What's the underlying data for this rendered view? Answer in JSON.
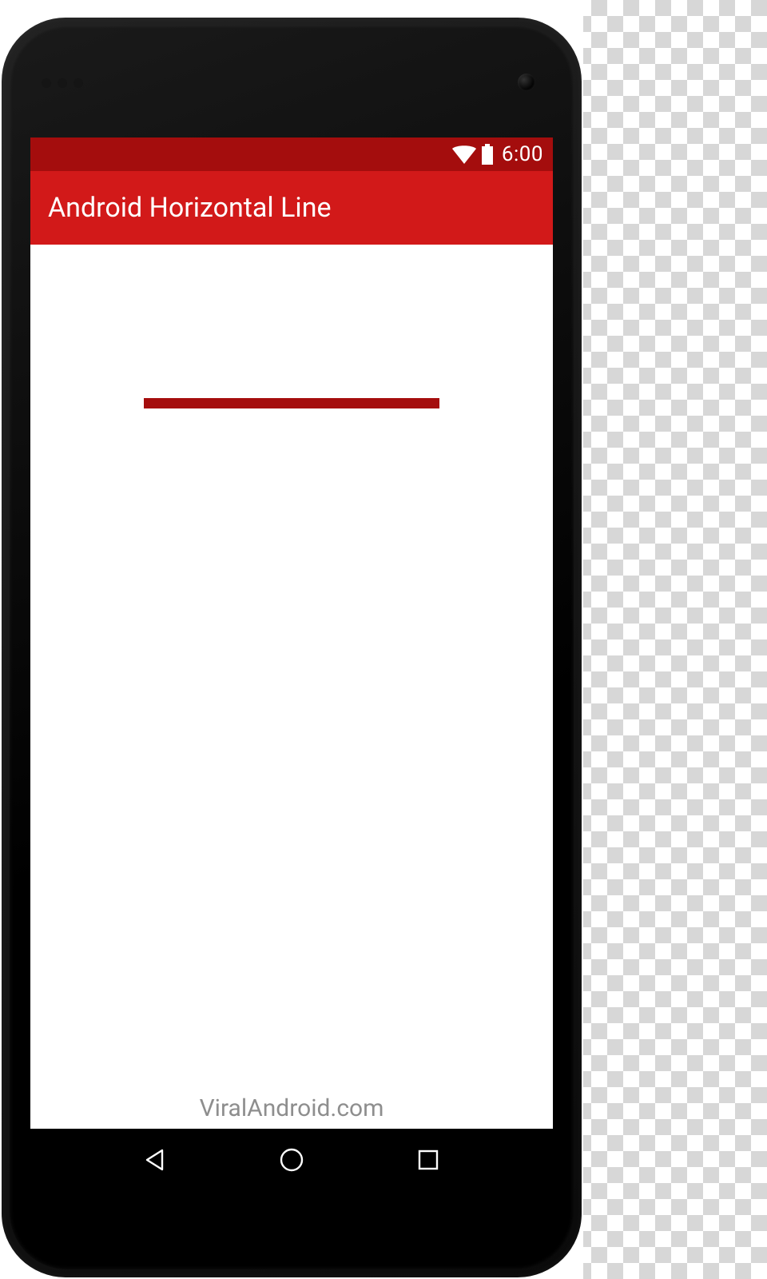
{
  "status_bar": {
    "time": "6:00"
  },
  "app_bar": {
    "title": "Android Horizontal Line"
  },
  "content": {
    "watermark": "ViralAndroid.com",
    "line_color": "#a50d0d"
  },
  "colors": {
    "status_bar_bg": "#a40d0d",
    "app_bar_bg": "#d21919"
  }
}
